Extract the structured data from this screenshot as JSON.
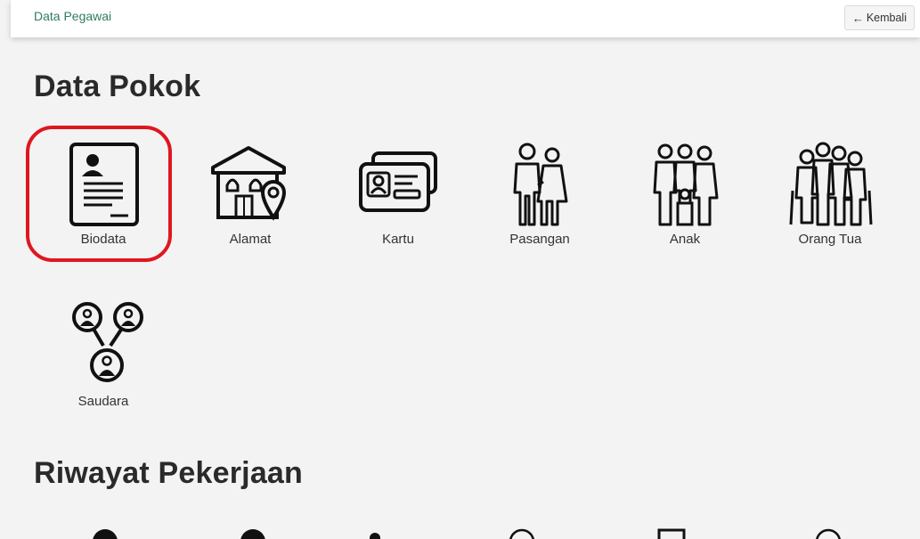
{
  "header": {
    "page_title": "Data Pegawai",
    "back_label": "Kembali",
    "back_icon": "arrow-left-icon"
  },
  "sections": [
    {
      "title": "Data Pokok",
      "items": [
        {
          "label": "Biodata",
          "icon": "biodata-icon",
          "selected": true
        },
        {
          "label": "Alamat",
          "icon": "house-location-icon"
        },
        {
          "label": "Kartu",
          "icon": "id-card-icon"
        },
        {
          "label": "Pasangan",
          "icon": "couple-icon"
        },
        {
          "label": "Anak",
          "icon": "family-children-icon"
        },
        {
          "label": "Orang Tua",
          "icon": "elderly-parents-icon"
        },
        {
          "label": "Saudara",
          "icon": "siblings-icon"
        }
      ]
    },
    {
      "title": "Riwayat Pekerjaan",
      "items": []
    }
  ],
  "colors": {
    "accent": "#2e7d5b",
    "highlight": "#e0161f",
    "background": "#f3f3f3"
  }
}
